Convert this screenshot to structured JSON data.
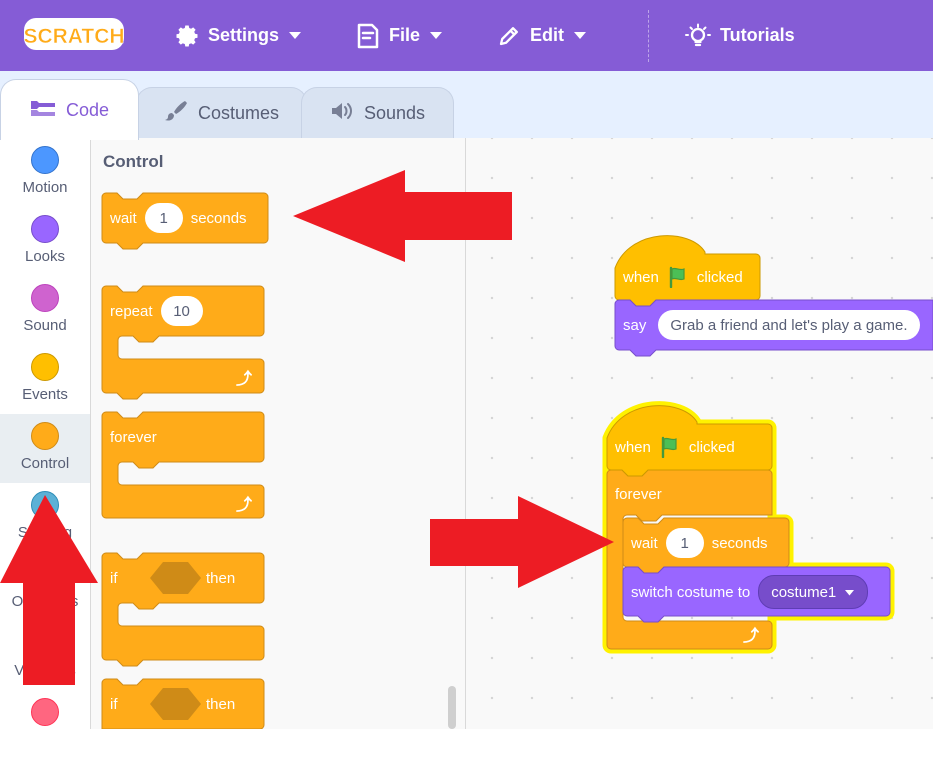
{
  "menubar": {
    "logo_text": "SCRATCH",
    "settings_label": "Settings",
    "file_label": "File",
    "edit_label": "Edit",
    "tutorials_label": "Tutorials"
  },
  "tabs": {
    "code": "Code",
    "costumes": "Costumes",
    "sounds": "Sounds"
  },
  "categories": [
    {
      "label": "Motion",
      "color": "#4c97ff"
    },
    {
      "label": "Looks",
      "color": "#9966ff"
    },
    {
      "label": "Sound",
      "color": "#cf63cf"
    },
    {
      "label": "Events",
      "color": "#ffbf00"
    },
    {
      "label": "Control",
      "color": "#ffab19"
    },
    {
      "label": "Sensing",
      "color": "#5cb1d6"
    },
    {
      "label": "Operators",
      "color": "#59c059"
    },
    {
      "label": "Variables",
      "color": "#ff8c1a"
    },
    {
      "label": "",
      "color": "#ff6680"
    }
  ],
  "palette": {
    "title": "Control",
    "wait": {
      "prefix": "wait",
      "value": "1",
      "suffix": "seconds"
    },
    "repeat": {
      "prefix": "repeat",
      "value": "10"
    },
    "forever": {
      "label": "forever"
    },
    "if_then_1": {
      "prefix": "if",
      "suffix": "then"
    },
    "if_then_2": {
      "prefix": "if",
      "suffix": "then"
    }
  },
  "workspace": {
    "script1": {
      "hat": {
        "prefix": "when",
        "suffix": "clicked"
      },
      "say": {
        "label": "say",
        "value": "Grab a friend and let's play a game."
      }
    },
    "script2": {
      "hat": {
        "prefix": "when",
        "suffix": "clicked"
      },
      "forever": "forever",
      "wait": {
        "prefix": "wait",
        "value": "1",
        "suffix": "seconds"
      },
      "switch": {
        "label": "switch costume to",
        "value": "costume1"
      }
    }
  },
  "colors": {
    "menubar": "#855cd6",
    "control": "#ffab19",
    "control_dark": "#cf8b17",
    "events": "#ffbf00",
    "looks": "#9966ff",
    "highlight": "#fff200",
    "arrow": "#ed1c24"
  }
}
